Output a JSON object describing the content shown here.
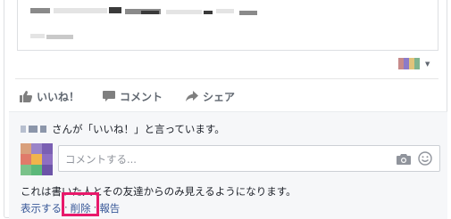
{
  "actions": {
    "like_label": "いいね！",
    "comment_label": "コメント",
    "share_label": "シェア"
  },
  "likes": {
    "text": "さんが「いいね！」と言っています。"
  },
  "comment": {
    "placeholder": "コメントする..."
  },
  "privacy_notice": "これは書いた人とその友達からのみ見えるようになります。",
  "links": {
    "show_label": "表示する",
    "delete_label": "削除",
    "report_label": "報告"
  },
  "icons": {
    "like": "thumbs-up-icon",
    "comment": "speech-bubble-icon",
    "share": "share-arrow-icon",
    "camera": "camera-icon",
    "emoji": "smiley-icon"
  },
  "colors": {
    "highlight": "#e8196a",
    "link": "#385898",
    "muted": "#606770"
  }
}
